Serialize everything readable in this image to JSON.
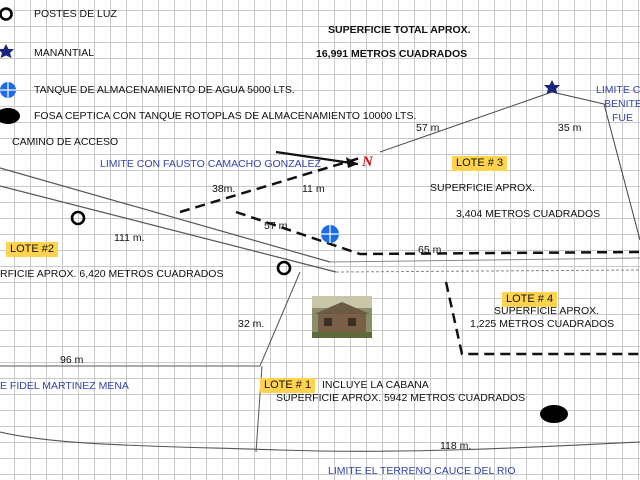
{
  "legend": {
    "poles": "POSTES DE LUZ",
    "spring": "MANANTIAL",
    "tank": "TANQUE DE ALMACENAMIENTO DE AGUA 5000  LTS.",
    "septic": "FOSA CEPTICA CON TANQUE ROTOPLAS DE ALMACENAMIENTO 10000 LTS."
  },
  "total": {
    "title": "SUPERFICIE TOTAL APROX.",
    "value": "16,991  METROS CUADRADOS"
  },
  "labels": {
    "access": "CAMINO  DE ACCESO",
    "north_arrow": "N",
    "fausto": "LIMITE CON FAUSTO CAMACHO GONZALEZ",
    "fidel": "E FIDEL MARTINEZ MENA",
    "river": "LIMITE EL TERRENO    CAUCE DEL RIO",
    "limit_right_1": "LIMITE C",
    "limit_right_2": "BENITE",
    "limit_right_3": "FUE"
  },
  "lots": {
    "lote1": {
      "name": "LOTE # 1",
      "note": "INCLUYE LA CABANA",
      "area": "SUPERFICIE APROX.  5942  METROS CUADRADOS"
    },
    "lote2": {
      "name": "LOTE #2",
      "area": "RFICIE APROX.  6,420 METROS CUADRADOS"
    },
    "lote3": {
      "name": "LOTE  # 3",
      "area_title": "SUPERFICIE APROX.",
      "area_value": "3,404 METROS CUADRADOS"
    },
    "lote4": {
      "name": "LOTE  # 4",
      "area_title": "SUPERFICIE APROX.",
      "area_value": "1,225 METROS CUADRADOS"
    }
  },
  "measurements": {
    "m57_top": "57 m",
    "m35": "35 m",
    "m38": "38m.",
    "m11": "11 m",
    "m57_mid": "57 m",
    "m111": "111 m.",
    "m65": "65 m",
    "m32": "32 m.",
    "m96": "96 m",
    "m118": "118 m."
  },
  "colors": {
    "spring_marker": "#1a237e",
    "tank_marker": "#1e6be6",
    "north_arrow": "#cc1111",
    "lot_label_bg": "#ffd34d",
    "blue_text": "#3344aa"
  }
}
